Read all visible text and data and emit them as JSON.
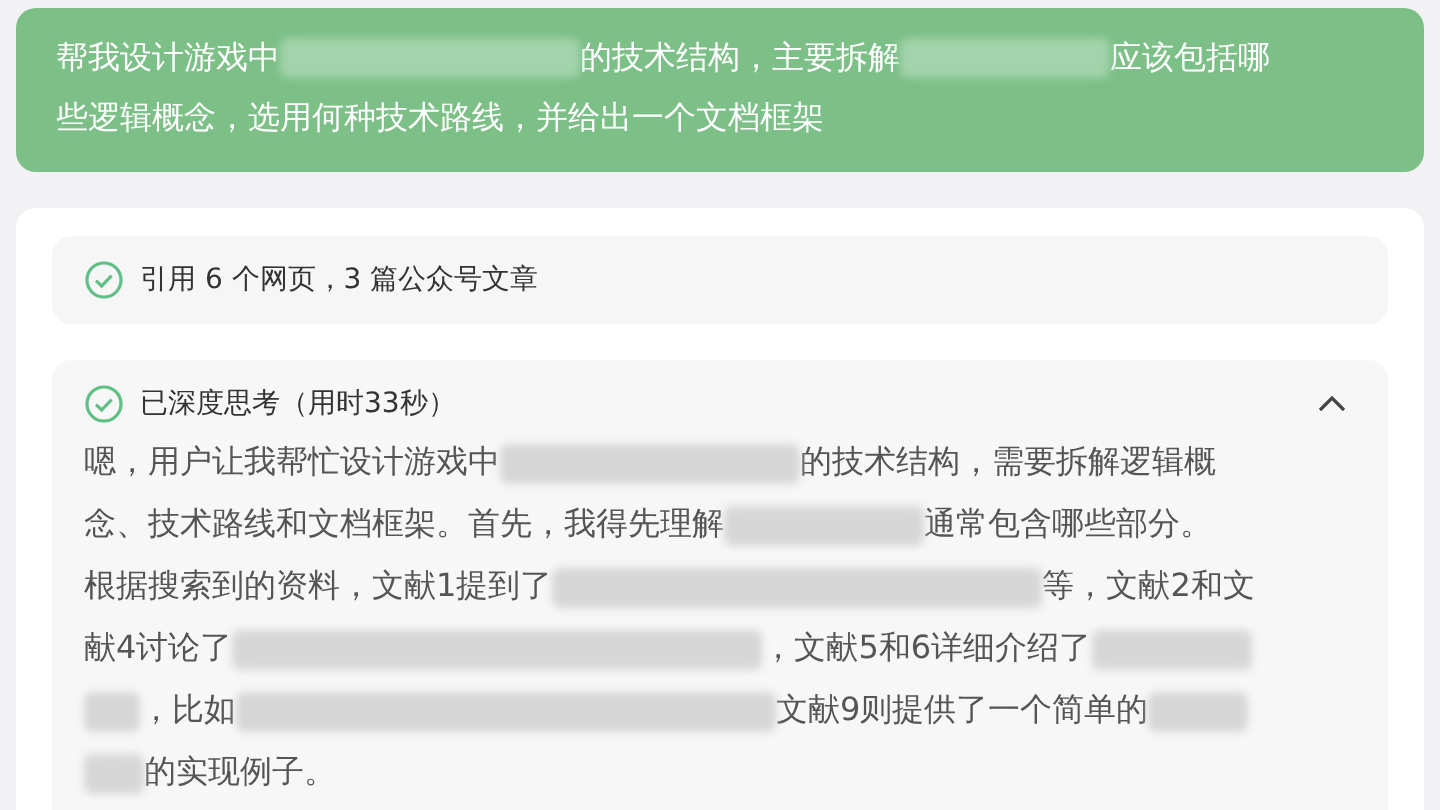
{
  "question": {
    "lines": [
      {
        "segments": [
          {
            "kind": "text",
            "text": "帮我设计游戏中"
          },
          {
            "kind": "redacted"
          },
          {
            "kind": "text",
            "text": "的技术结构，主要拆解"
          },
          {
            "kind": "redacted"
          },
          {
            "kind": "text",
            "text": "应该包括哪"
          }
        ]
      },
      {
        "segments": [
          {
            "kind": "text",
            "text": "些逻辑概念，选用何种技术路线，并给出一个文档框架"
          }
        ]
      }
    ]
  },
  "citation": {
    "text": "引用 6 个网页，3 篇公众号文章"
  },
  "thinking": {
    "title": "已深度思考（用时33秒）",
    "expanded": true,
    "lines": [
      {
        "segments": [
          {
            "kind": "text",
            "text": "嗯，用户让我帮忙设计游戏中"
          },
          {
            "kind": "redacted"
          },
          {
            "kind": "text",
            "text": "的技术结构，需要拆解逻辑概"
          }
        ]
      },
      {
        "segments": [
          {
            "kind": "text",
            "text": "念、技术路线和文档框架。首先，我得先理解"
          },
          {
            "kind": "redacted"
          },
          {
            "kind": "text",
            "text": "通常包含哪些部分。"
          }
        ]
      },
      {
        "segments": [
          {
            "kind": "text",
            "text": "根据搜索到的资料，文献1提到了"
          },
          {
            "kind": "redacted"
          },
          {
            "kind": "text",
            "text": "等，文献2和文"
          }
        ]
      },
      {
        "segments": [
          {
            "kind": "text",
            "text": "献4讨论了"
          },
          {
            "kind": "redacted"
          },
          {
            "kind": "text",
            "text": "，文献5和6详细介绍了"
          },
          {
            "kind": "redacted"
          }
        ]
      },
      {
        "segments": [
          {
            "kind": "redacted"
          },
          {
            "kind": "text",
            "text": "，比如"
          },
          {
            "kind": "redacted"
          },
          {
            "kind": "text",
            "text": "文献9则提供了一个简单的"
          },
          {
            "kind": "redacted"
          }
        ]
      },
      {
        "segments": [
          {
            "kind": "redacted"
          },
          {
            "kind": "text",
            "text": "的实现例子。"
          }
        ]
      }
    ]
  }
}
